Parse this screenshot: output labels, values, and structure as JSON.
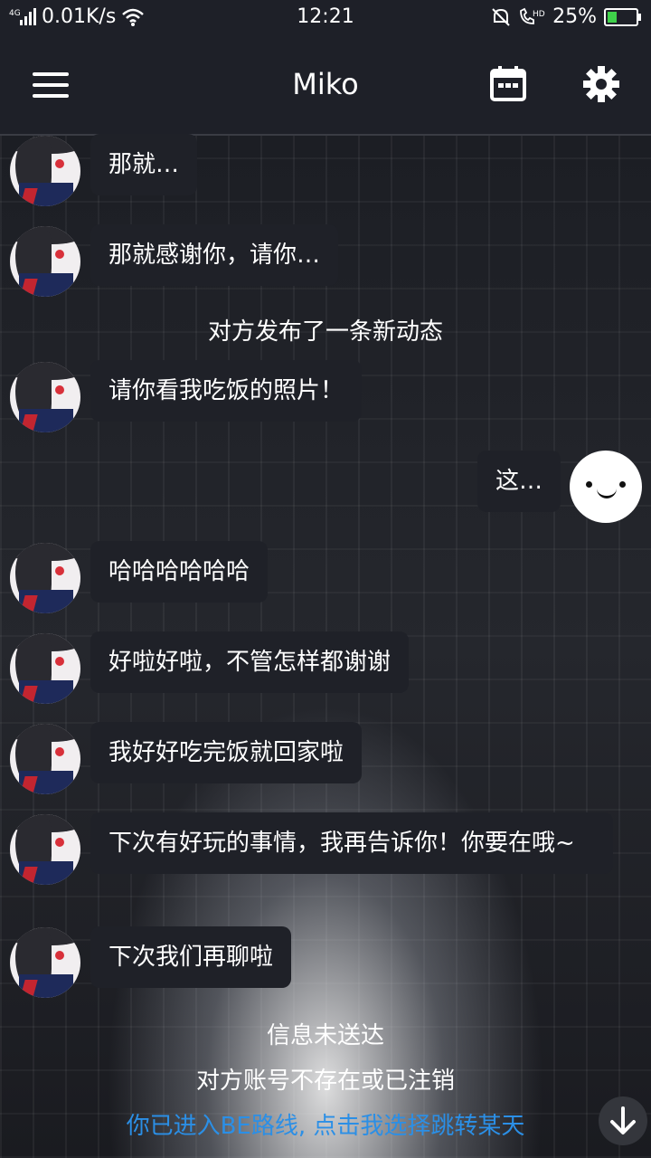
{
  "status_bar": {
    "network": "4G",
    "speed": "0.01K/s",
    "time": "12:21",
    "hd": "HD",
    "battery": "25%"
  },
  "header": {
    "title": "Miko",
    "icons": [
      "menu-icon",
      "calendar-icon",
      "gear-icon"
    ]
  },
  "messages": [
    {
      "sender": "them",
      "text": "那就…"
    },
    {
      "sender": "them",
      "text": "那就感谢你，请你…"
    },
    {
      "sender": "system",
      "text": "对方发布了一条新动态"
    },
    {
      "sender": "them",
      "text": "请你看我吃饭的照片！"
    },
    {
      "sender": "me",
      "text": "这…"
    },
    {
      "sender": "them",
      "text": "哈哈哈哈哈哈"
    },
    {
      "sender": "them",
      "text": "好啦好啦，不管怎样都谢谢"
    },
    {
      "sender": "them",
      "text": "我好好吃完饭就回家啦"
    },
    {
      "sender": "them",
      "text": "下次有好玩的事情，我再告诉你！你要在哦~"
    },
    {
      "sender": "them",
      "text": "下次我们再聊啦"
    },
    {
      "sender": "system",
      "text": "信息未送达"
    },
    {
      "sender": "system",
      "text": "对方账号不存在或已注销"
    }
  ],
  "be_link": "你已进入BE路线, 点击我选择跳转某天",
  "colors": {
    "link": "#2b8fe6",
    "bubble": "#1f2128",
    "header": "#1e2028"
  }
}
